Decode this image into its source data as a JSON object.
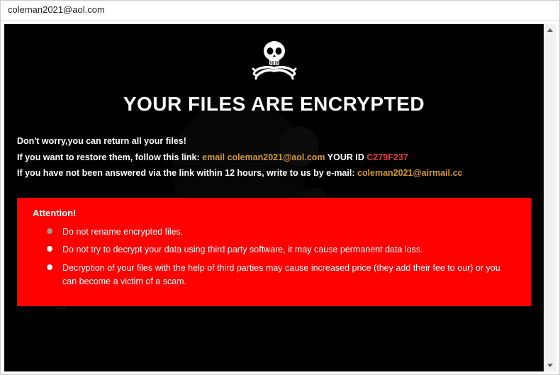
{
  "window": {
    "title": "coleman2021@aol.com"
  },
  "content": {
    "headline": "YOUR FILES ARE ENCRYPTED",
    "line1": "Don't worry,you can return all your files!",
    "line2_prefix": "If you want to restore them, follow this link: ",
    "line2_email_label": "email ",
    "line2_email": "coleman2021@aol.com",
    "line2_id_label": "  YOUR ID ",
    "line2_id_value": "C279F237",
    "line3_prefix": "If you have not been answered via the link within 12 hours, write to us by e-mail: ",
    "line3_email": "coleman2021@airmail.cc"
  },
  "attention": {
    "title": "Attention!",
    "items": [
      "Do not rename encrypted files.",
      "Do not try to decrypt your data using third party software, it may cause permanent data loss.",
      "Decryption of your files with the help of third parties may cause increased price (they add their fee to our) or you can become a victim of a scam."
    ]
  },
  "icons": {
    "skull": "skull-crossbones"
  }
}
